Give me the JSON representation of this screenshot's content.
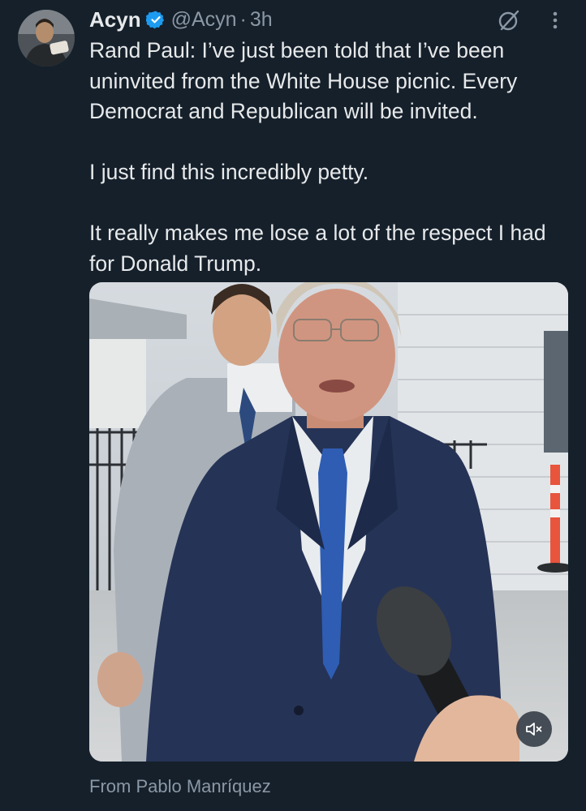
{
  "author": {
    "name": "Acyn",
    "handle": "@Acyn",
    "separator": "·",
    "time": "3h",
    "verified": true,
    "avatar_icon": "avatar"
  },
  "actions": {
    "grok_icon": "grok-icon",
    "more_icon": "more-icon"
  },
  "tweet": {
    "paragraphs": [
      "Rand Paul: I’ve just been told that I’ve been uninvited from the White House picnic. Every Democrat and Republican will be invited.",
      "I just find this incredibly petty.",
      "It really makes me lose a lot of the respect I had for Donald Trump."
    ]
  },
  "media": {
    "type": "video",
    "mute_icon": "volume-muted-icon",
    "attribution": "From Pablo Manríquez"
  },
  "colors": {
    "background": "#15202b",
    "text": "#e7e9ea",
    "secondary": "#8b98a5",
    "verified": "#1d9bf0"
  }
}
